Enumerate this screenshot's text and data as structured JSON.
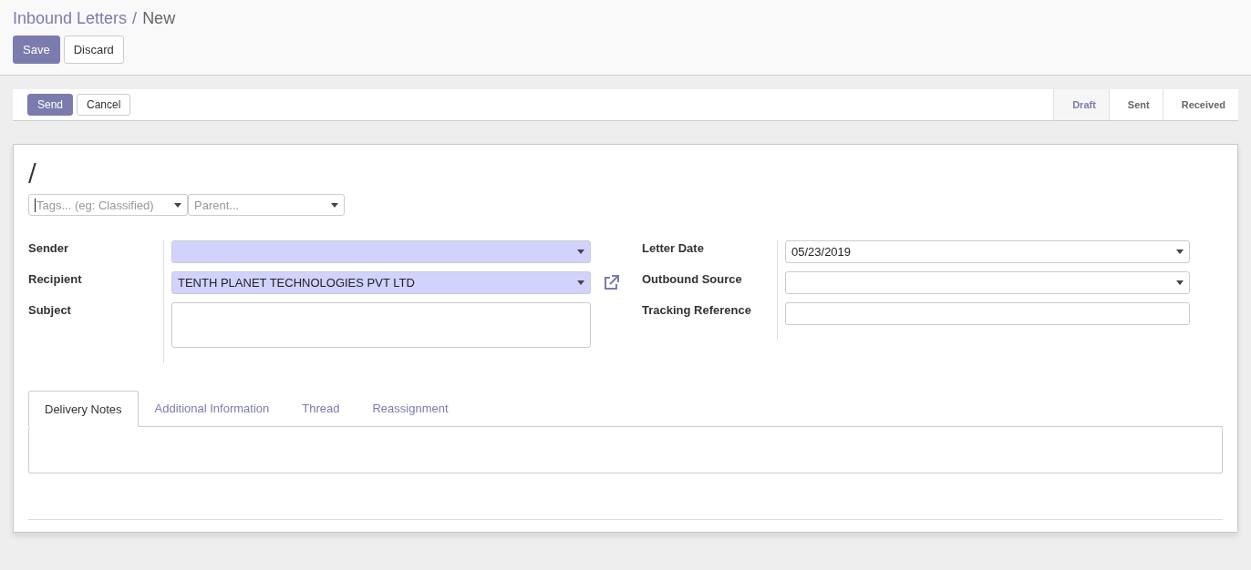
{
  "breadcrumb": {
    "parent": "Inbound Letters",
    "separator": "/",
    "current": "New"
  },
  "actions": [
    {
      "label": "Save",
      "kind": "primary"
    },
    {
      "label": "Discard",
      "kind": "secondary"
    }
  ],
  "header_buttons": [
    {
      "label": "Send",
      "kind": "primary"
    },
    {
      "label": "Cancel",
      "kind": "secondary"
    }
  ],
  "status_steps": [
    {
      "label": "Draft",
      "selected": true
    },
    {
      "label": "Sent",
      "selected": false
    },
    {
      "label": "Received",
      "selected": false
    }
  ],
  "title": "/",
  "tag_fields": [
    {
      "placeholder": "Tags... (eg: Classified)",
      "focused": true
    },
    {
      "placeholder": "Parent...",
      "focused": false
    }
  ],
  "left_fields": [
    {
      "label": "Sender",
      "kind": "select",
      "required": true,
      "external_link": false
    },
    {
      "label": "Recipient",
      "kind": "select",
      "required": true,
      "value": "TENTH PLANET TECHNOLOGIES PVT LTD",
      "external_link": true
    },
    {
      "label": "Subject",
      "kind": "textarea",
      "required": false,
      "external_link": false
    }
  ],
  "right_fields": [
    {
      "label": "Letter Date",
      "kind": "select",
      "required": false,
      "value": "05/23/2019",
      "external_link": false
    },
    {
      "label": "Outbound Source",
      "kind": "select",
      "required": false,
      "external_link": false
    },
    {
      "label": "Tracking Reference",
      "kind": "text",
      "required": false,
      "external_link": false
    }
  ],
  "tabs": [
    {
      "label": "Delivery Notes",
      "selected": true
    },
    {
      "label": "Additional Information",
      "selected": false
    },
    {
      "label": "Thread",
      "selected": false
    },
    {
      "label": "Reassignment",
      "selected": false
    }
  ]
}
